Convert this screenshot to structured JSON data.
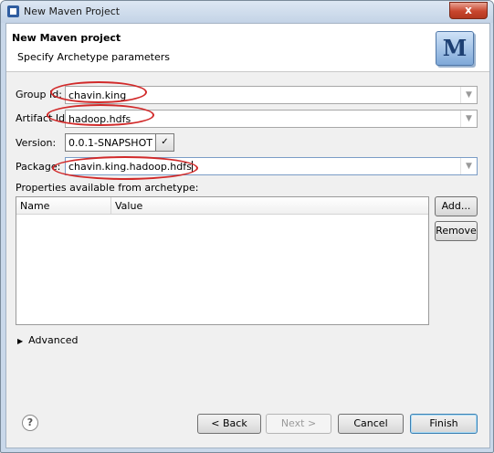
{
  "window": {
    "title": "New Maven Project",
    "close_label": "x"
  },
  "header": {
    "title": "New Maven project",
    "subtitle": "Specify Archetype parameters",
    "logo_letter": "M"
  },
  "form": {
    "group_id": {
      "label": "Group Id:",
      "value": "chavin.king"
    },
    "artifact_id": {
      "label": "Artifact Id:",
      "value": "hadoop.hdfs"
    },
    "version": {
      "label": "Version:",
      "value": "0.0.1-SNAPSHOT"
    },
    "package": {
      "label": "Package:",
      "value": "chavin.king.hadoop.hdfs"
    }
  },
  "properties": {
    "label": "Properties available from archetype:",
    "columns": [
      "Name",
      "Value"
    ],
    "rows": []
  },
  "side_buttons": {
    "add": "Add...",
    "remove": "Remove"
  },
  "advanced": {
    "label": "Advanced"
  },
  "footer": {
    "help": "?",
    "back": "< Back",
    "next": "Next >",
    "cancel": "Cancel",
    "finish": "Finish"
  },
  "colors": {
    "annotation_oval": "#d12a2a"
  }
}
